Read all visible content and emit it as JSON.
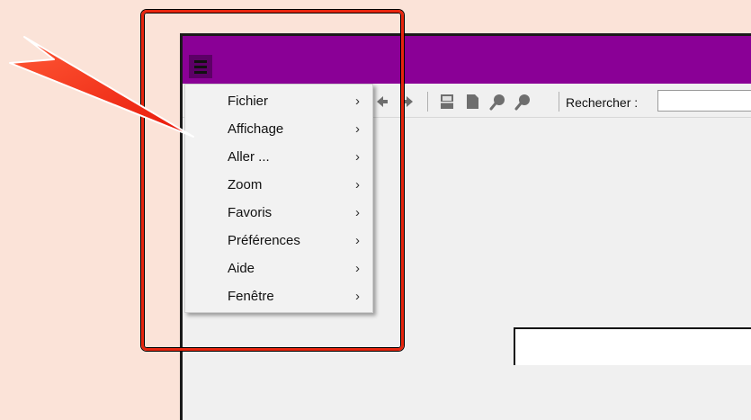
{
  "toolbar": {
    "search_label": "Rechercher :",
    "search_value": "",
    "icons": [
      "nav-back-icon",
      "nav-forward-icon",
      "page-layout-icon",
      "page-icon",
      "zoom-out-icon",
      "zoom-in-icon"
    ]
  },
  "menu": {
    "items": [
      {
        "label": "Fichier",
        "chevron": "›"
      },
      {
        "label": "Affichage",
        "chevron": "›"
      },
      {
        "label": "Aller ...",
        "chevron": "›"
      },
      {
        "label": "Zoom",
        "chevron": "›"
      },
      {
        "label": "Favoris",
        "chevron": "›"
      },
      {
        "label": "Préférences",
        "chevron": "›"
      },
      {
        "label": "Aide",
        "chevron": "›"
      },
      {
        "label": "Fenêtre",
        "chevron": "›"
      }
    ]
  },
  "colors": {
    "background": "#fbe3d8",
    "title_bar": "#8a0096",
    "annotation": "#e8250e"
  }
}
